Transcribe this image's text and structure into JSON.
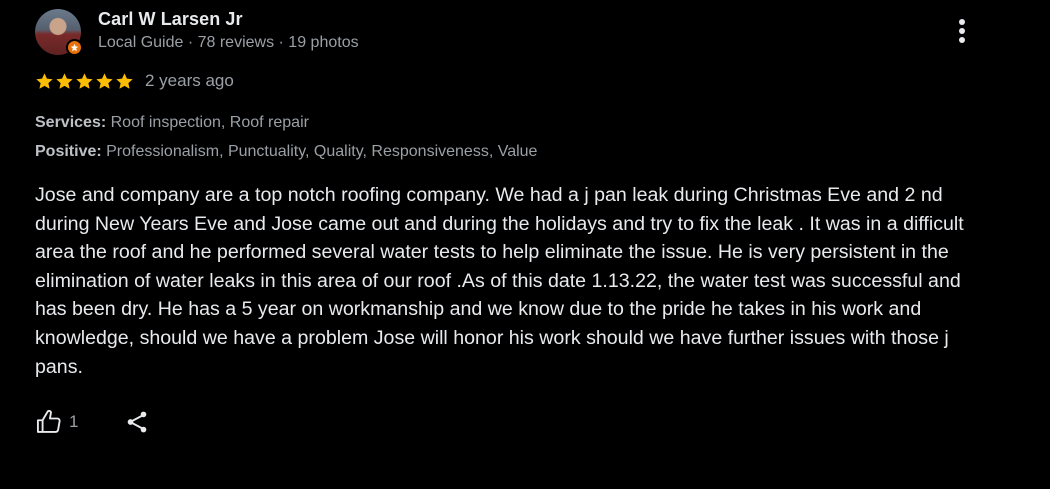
{
  "review": {
    "author": {
      "name": "Carl W Larsen Jr",
      "meta": "Local Guide · 78 reviews · 19 photos"
    },
    "rating": {
      "stars": 5,
      "max_stars": 5,
      "star_color": "#fbbc04",
      "time_ago": "2 years ago"
    },
    "attributes": {
      "services": {
        "label": "Services:",
        "value": " Roof inspection, Roof repair"
      },
      "positive": {
        "label": "Positive:",
        "value": " Professionalism, Punctuality, Quality, Responsiveness, Value"
      }
    },
    "text": "Jose and company are a top notch roofing company. We had a j pan leak during Christmas Eve and 2 nd during New Years Eve and Jose came out and during the holidays and try to fix the leak . It was in a difficult area the roof and he performed several water tests to help eliminate the issue. He is very persistent in the elimination of water leaks in this area of our roof .As of this date 1.13.22, the water test was successful and has been dry. He has a 5 year on workmanship and we know due to the pride he takes in his work and knowledge, should we have a problem Jose will honor his work should we have further issues with those j pans.",
    "actions": {
      "like_count": "1",
      "like_icon": "thumbs-up-icon",
      "share_icon": "share-icon",
      "more_icon": "more-vertical-icon"
    },
    "badge_icon": "local-guide-star-icon",
    "accent_color": "#e8710a"
  }
}
